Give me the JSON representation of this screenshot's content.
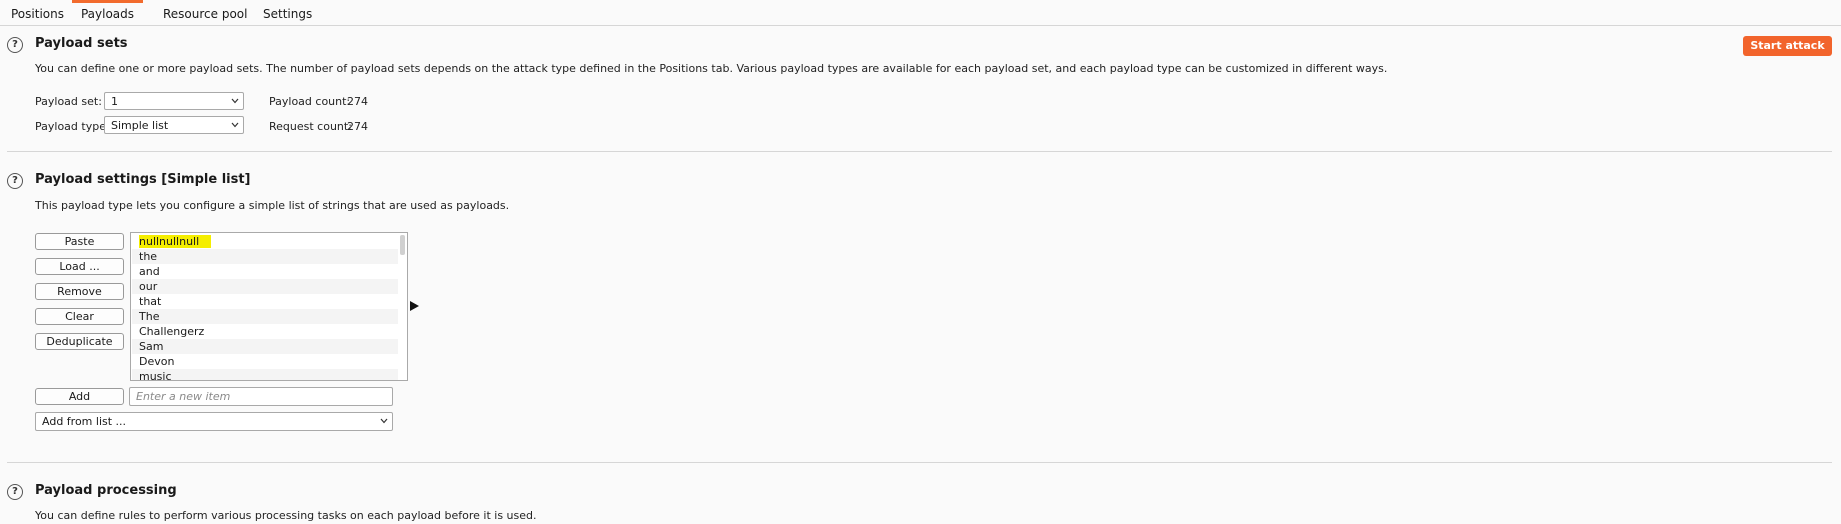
{
  "tabs": [
    {
      "label": "Positions"
    },
    {
      "label": "Payloads"
    },
    {
      "label": "Resource pool"
    },
    {
      "label": "Settings"
    }
  ],
  "payload_sets": {
    "title": "Payload sets",
    "description": "You can define one or more payload sets. The number of payload sets depends on the attack type defined in the Positions tab. Various payload types are available for each payload set, and each payload type can be customized in different ways.",
    "start_attack": "Start attack",
    "payload_set_label": "Payload set:",
    "payload_set_value": "1",
    "payload_type_label": "Payload type:",
    "payload_type_value": "Simple list",
    "payload_count_label": "Payload count:",
    "payload_count_value": "274",
    "request_count_label": "Request count:",
    "request_count_value": "274"
  },
  "payload_settings": {
    "title": "Payload settings [Simple list]",
    "description": "This payload type lets you configure a simple list of strings that are used as payloads.",
    "buttons": {
      "paste": "Paste",
      "load": "Load ...",
      "remove": "Remove",
      "clear": "Clear",
      "deduplicate": "Deduplicate",
      "add": "Add"
    },
    "items": [
      "nullnullnull",
      "the",
      "and",
      "our",
      "that",
      "The",
      "Challengerz",
      "Sam",
      "Devon",
      "music"
    ],
    "new_item_placeholder": "Enter a new item",
    "add_from_list": "Add from list ..."
  },
  "payload_processing": {
    "title": "Payload processing",
    "description": "You can define rules to perform various processing tasks on each payload before it is used."
  },
  "colors": {
    "accent": "#f2642c",
    "highlight": "#f5ee00"
  }
}
